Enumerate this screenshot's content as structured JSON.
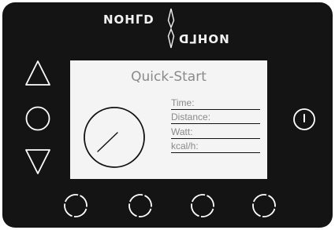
{
  "brand": {
    "name_top": "NOHᒥD",
    "name_bottom": "NOHᒥD"
  },
  "screen": {
    "title": "Quick-Start",
    "fields": [
      "Time:",
      "Distance:",
      "Watt:",
      "kcal/h:"
    ]
  },
  "colors": {
    "panel": "#141414",
    "screen": "#f4f4f4",
    "title_text": "#8a8a8a",
    "outline": "#ffffff"
  },
  "icons": {
    "up": "triangle-up-icon",
    "circle": "circle-icon",
    "down": "triangle-down-icon",
    "power": "power-icon"
  }
}
